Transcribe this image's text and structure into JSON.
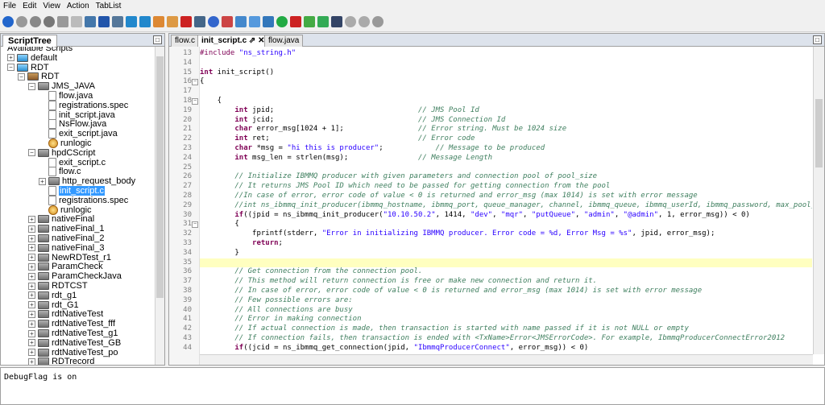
{
  "menu": [
    "File",
    "Edit",
    "View",
    "Action",
    "TabList"
  ],
  "toolbar_icons": [
    {
      "name": "run-icon",
      "color": "#2266cc",
      "round": true
    },
    {
      "name": "stop-icon",
      "color": "#999999",
      "round": true
    },
    {
      "name": "record-icon",
      "color": "#888888",
      "round": true
    },
    {
      "name": "pause-icon",
      "color": "#777777",
      "round": true
    },
    {
      "name": "step-icon",
      "color": "#999999",
      "round": false
    },
    {
      "name": "comment-icon",
      "color": "#bbbbbb",
      "round": false
    },
    {
      "name": "window-icon",
      "color": "#4477aa",
      "round": false
    },
    {
      "name": "save-icon",
      "color": "#2255aa",
      "round": false
    },
    {
      "name": "copy-icon",
      "color": "#557799",
      "round": false
    },
    {
      "name": "download-icon",
      "color": "#2288cc",
      "round": false
    },
    {
      "name": "upload-icon",
      "color": "#2288cc",
      "round": false
    },
    {
      "name": "palette-icon",
      "color": "#dd8833",
      "round": false
    },
    {
      "name": "tag-icon",
      "color": "#dd9944",
      "round": false
    },
    {
      "name": "delete-icon",
      "color": "#cc2222",
      "round": false
    },
    {
      "name": "search-icon",
      "color": "#446688",
      "round": false
    },
    {
      "name": "settings-icon",
      "color": "#3366cc",
      "round": true
    },
    {
      "name": "edit-icon",
      "color": "#cc4444",
      "round": false
    },
    {
      "name": "disk-icon",
      "color": "#4488cc",
      "round": false
    },
    {
      "name": "network-icon",
      "color": "#5599dd",
      "round": false
    },
    {
      "name": "list-icon",
      "color": "#3377bb",
      "round": false
    },
    {
      "name": "refresh-icon",
      "color": "#22aa44",
      "round": true
    },
    {
      "name": "flag-icon",
      "color": "#cc2222",
      "round": false
    },
    {
      "name": "chart-icon",
      "color": "#44aa44",
      "round": false
    },
    {
      "name": "export-icon",
      "color": "#33aa55",
      "round": false
    },
    {
      "name": "floppy-icon",
      "color": "#334466",
      "round": false
    },
    {
      "name": "undo-icon",
      "color": "#aaaaaa",
      "round": true
    },
    {
      "name": "forward-icon",
      "color": "#aaaaaa",
      "round": true
    },
    {
      "name": "record-stop-icon",
      "color": "#999999",
      "round": true
    }
  ],
  "left_panel": {
    "tab_label": "ScriptTree",
    "tree": [
      {
        "label": "Available Scripts",
        "depth": 0,
        "exp": "",
        "icon": "",
        "partial": true
      },
      {
        "label": "default",
        "depth": 0,
        "exp": "+",
        "icon": "db"
      },
      {
        "label": "RDT",
        "depth": 0,
        "exp": "−",
        "icon": "db"
      },
      {
        "label": "RDT",
        "depth": 1,
        "exp": "−",
        "icon": "box"
      },
      {
        "label": "JMS_JAVA",
        "depth": 2,
        "exp": "−",
        "icon": "folder"
      },
      {
        "label": "flow.java",
        "depth": 3,
        "exp": "",
        "icon": "file"
      },
      {
        "label": "registrations.spec",
        "depth": 3,
        "exp": "",
        "icon": "file"
      },
      {
        "label": "init_script.java",
        "depth": 3,
        "exp": "",
        "icon": "file"
      },
      {
        "label": "NsFlow.java",
        "depth": 3,
        "exp": "",
        "icon": "file"
      },
      {
        "label": "exit_script.java",
        "depth": 3,
        "exp": "",
        "icon": "file"
      },
      {
        "label": "runlogic",
        "depth": 3,
        "exp": "",
        "icon": "logic"
      },
      {
        "label": "hpdCScript",
        "depth": 2,
        "exp": "−",
        "icon": "folder"
      },
      {
        "label": "exit_script.c",
        "depth": 3,
        "exp": "",
        "icon": "file"
      },
      {
        "label": "flow.c",
        "depth": 3,
        "exp": "",
        "icon": "file"
      },
      {
        "label": "http_request_body",
        "depth": 3,
        "exp": "+",
        "icon": "folder"
      },
      {
        "label": "init_script.c",
        "depth": 3,
        "exp": "",
        "icon": "file",
        "selected": true
      },
      {
        "label": "registrations.spec",
        "depth": 3,
        "exp": "",
        "icon": "file"
      },
      {
        "label": "runlogic",
        "depth": 3,
        "exp": "",
        "icon": "logic"
      },
      {
        "label": "nativeFinal",
        "depth": 2,
        "exp": "+",
        "icon": "folder"
      },
      {
        "label": "nativeFinal_1",
        "depth": 2,
        "exp": "+",
        "icon": "folder"
      },
      {
        "label": "nativeFinal_2",
        "depth": 2,
        "exp": "+",
        "icon": "folder"
      },
      {
        "label": "nativeFinal_3",
        "depth": 2,
        "exp": "+",
        "icon": "folder"
      },
      {
        "label": "NewRDTest_r1",
        "depth": 2,
        "exp": "+",
        "icon": "folder"
      },
      {
        "label": "ParamCheck",
        "depth": 2,
        "exp": "+",
        "icon": "folder"
      },
      {
        "label": "ParamCheckJava",
        "depth": 2,
        "exp": "+",
        "icon": "folder"
      },
      {
        "label": "RDTCST",
        "depth": 2,
        "exp": "+",
        "icon": "folder"
      },
      {
        "label": "rdt_g1",
        "depth": 2,
        "exp": "+",
        "icon": "folder"
      },
      {
        "label": "rdt_G1",
        "depth": 2,
        "exp": "+",
        "icon": "folder"
      },
      {
        "label": "rdtNativeTest",
        "depth": 2,
        "exp": "+",
        "icon": "folder"
      },
      {
        "label": "rdtNativeTest_fff",
        "depth": 2,
        "exp": "+",
        "icon": "folder"
      },
      {
        "label": "rdtNativeTest_g1",
        "depth": 2,
        "exp": "+",
        "icon": "folder"
      },
      {
        "label": "rdtNativeTest_GB",
        "depth": 2,
        "exp": "+",
        "icon": "folder"
      },
      {
        "label": "rdtNativeTest_po",
        "depth": 2,
        "exp": "+",
        "icon": "folder"
      },
      {
        "label": "RDTrecord",
        "depth": 2,
        "exp": "+",
        "icon": "folder"
      }
    ]
  },
  "editor": {
    "tabs": [
      {
        "label": "flow.c",
        "active": false
      },
      {
        "label": "init_script.c",
        "active": true,
        "pin": "⇗",
        "close": "✕"
      },
      {
        "label": "flow.java",
        "active": false
      }
    ],
    "highlight_line": 35,
    "lines": [
      {
        "n": 13,
        "fold": "",
        "t": [
          [
            "pp",
            "#include "
          ],
          [
            "str",
            "\"ns_string.h\""
          ]
        ]
      },
      {
        "n": 14,
        "fold": "",
        "t": []
      },
      {
        "n": 15,
        "fold": "",
        "t": [
          [
            "kw",
            "int"
          ],
          [
            "pl",
            " init_script()"
          ]
        ]
      },
      {
        "n": 16,
        "fold": "−",
        "t": [
          [
            "pl",
            "{"
          ]
        ]
      },
      {
        "n": 17,
        "fold": "",
        "t": []
      },
      {
        "n": 18,
        "fold": "−",
        "t": [
          [
            "pl",
            "    {"
          ]
        ]
      },
      {
        "n": 19,
        "fold": "",
        "t": [
          [
            "pl",
            "        "
          ],
          [
            "kw",
            "int"
          ],
          [
            "pl",
            " jpid;                                 "
          ],
          [
            "cm",
            "// JMS Pool Id"
          ]
        ]
      },
      {
        "n": 20,
        "fold": "",
        "t": [
          [
            "pl",
            "        "
          ],
          [
            "kw",
            "int"
          ],
          [
            "pl",
            " jcid;                                 "
          ],
          [
            "cm",
            "// JMS Connection Id"
          ]
        ]
      },
      {
        "n": 21,
        "fold": "",
        "t": [
          [
            "pl",
            "        "
          ],
          [
            "kw",
            "char"
          ],
          [
            "pl",
            " error_msg[1024 + 1];                 "
          ],
          [
            "cm",
            "// Error string. Must be 1024 size"
          ]
        ]
      },
      {
        "n": 22,
        "fold": "",
        "t": [
          [
            "pl",
            "        "
          ],
          [
            "kw",
            "int"
          ],
          [
            "pl",
            " ret;                                  "
          ],
          [
            "cm",
            "// Error code"
          ]
        ]
      },
      {
        "n": 23,
        "fold": "",
        "t": [
          [
            "pl",
            "        "
          ],
          [
            "kw",
            "char"
          ],
          [
            "pl",
            " *msg = "
          ],
          [
            "str",
            "\"hi this is producer\""
          ],
          [
            "pl",
            ";            "
          ],
          [
            "cm",
            "// Message to be produced"
          ]
        ]
      },
      {
        "n": 24,
        "fold": "",
        "t": [
          [
            "pl",
            "        "
          ],
          [
            "kw",
            "int"
          ],
          [
            "pl",
            " msg_len = strlen(msg);                "
          ],
          [
            "cm",
            "// Message Length"
          ]
        ]
      },
      {
        "n": 25,
        "fold": "",
        "t": []
      },
      {
        "n": 26,
        "fold": "",
        "t": [
          [
            "pl",
            "        "
          ],
          [
            "cm",
            "// Initialize IBMMQ producer with given parameters and connection pool of pool_size"
          ]
        ]
      },
      {
        "n": 27,
        "fold": "",
        "t": [
          [
            "pl",
            "        "
          ],
          [
            "cm",
            "// It returns JMS Pool ID which need to be passed for getting connection from the pool"
          ]
        ]
      },
      {
        "n": 28,
        "fold": "",
        "t": [
          [
            "pl",
            "        "
          ],
          [
            "cm",
            "//In case of error, error code of value < 0 is returned and error_msg (max 1014) is set with error message"
          ]
        ]
      },
      {
        "n": 29,
        "fold": "",
        "t": [
          [
            "pl",
            "        "
          ],
          [
            "cm",
            "//int ns_ibmmq_init_producer(ibmmq_hostname, ibmmq_port, queue_manager, channel, ibmmq_queue, ibmmq_userId, ibmmq_password, max_pool_size"
          ]
        ]
      },
      {
        "n": 30,
        "fold": "",
        "t": [
          [
            "pl",
            "        "
          ],
          [
            "kw",
            "if"
          ],
          [
            "pl",
            "((jpid = ns_ibmmq_init_producer("
          ],
          [
            "str",
            "\"10.10.50.2\""
          ],
          [
            "pl",
            ", 1414, "
          ],
          [
            "str",
            "\"dev\""
          ],
          [
            "pl",
            ", "
          ],
          [
            "str",
            "\"mqr\""
          ],
          [
            "pl",
            ", "
          ],
          [
            "str",
            "\"putQueue\""
          ],
          [
            "pl",
            ", "
          ],
          [
            "str",
            "\"admin\""
          ],
          [
            "pl",
            ", "
          ],
          [
            "str",
            "\"@admin\""
          ],
          [
            "pl",
            ", 1, error_msg)) < 0)"
          ]
        ]
      },
      {
        "n": 31,
        "fold": "−",
        "t": [
          [
            "pl",
            "        {"
          ]
        ]
      },
      {
        "n": 32,
        "fold": "",
        "t": [
          [
            "pl",
            "            fprintf(stderr, "
          ],
          [
            "str",
            "\"Error in initializing IBMMQ producer. Error code = %d, Error Msg = %s\""
          ],
          [
            "pl",
            ", jpid, error_msg);"
          ]
        ]
      },
      {
        "n": 33,
        "fold": "",
        "t": [
          [
            "pl",
            "            "
          ],
          [
            "kw",
            "return"
          ],
          [
            "pl",
            ";"
          ]
        ]
      },
      {
        "n": 34,
        "fold": "",
        "t": [
          [
            "pl",
            "        }"
          ]
        ]
      },
      {
        "n": 35,
        "fold": "",
        "t": []
      },
      {
        "n": 36,
        "fold": "",
        "t": [
          [
            "pl",
            "        "
          ],
          [
            "cm",
            "// Get connection from the connection pool."
          ]
        ]
      },
      {
        "n": 37,
        "fold": "",
        "t": [
          [
            "pl",
            "        "
          ],
          [
            "cm",
            "// This method will return connection is free or make new connection and return it."
          ]
        ]
      },
      {
        "n": 38,
        "fold": "",
        "t": [
          [
            "pl",
            "        "
          ],
          [
            "cm",
            "// In case of error, error code of value < 0 is returned and error_msg (max 1014) is set with error message"
          ]
        ]
      },
      {
        "n": 39,
        "fold": "",
        "t": [
          [
            "pl",
            "        "
          ],
          [
            "cm",
            "// Few possible errors are:"
          ]
        ]
      },
      {
        "n": 40,
        "fold": "",
        "t": [
          [
            "pl",
            "        "
          ],
          [
            "cm",
            "// All connections are busy"
          ]
        ]
      },
      {
        "n": 41,
        "fold": "",
        "t": [
          [
            "pl",
            "        "
          ],
          [
            "cm",
            "// Error in making connection"
          ]
        ]
      },
      {
        "n": 42,
        "fold": "",
        "t": [
          [
            "pl",
            "        "
          ],
          [
            "cm",
            "// If actual connection is made, then transaction is started with name passed if it is not NULL or empty"
          ]
        ]
      },
      {
        "n": 43,
        "fold": "",
        "t": [
          [
            "pl",
            "        "
          ],
          [
            "cm",
            "// If connection fails, then transaction is ended with <TxName>Error<JMSErrorCode>. For example, IbmmqProducerConnectError2012"
          ]
        ]
      },
      {
        "n": 44,
        "fold": "",
        "t": [
          [
            "pl",
            "        "
          ],
          [
            "kw",
            "if"
          ],
          [
            "pl",
            "((jcid = ns_ibmmq_get_connection(jpid, "
          ],
          [
            "str",
            "\"IbmmqProducerConnect\""
          ],
          [
            "pl",
            ", error_msg)) < 0)"
          ]
        ]
      }
    ]
  },
  "console": {
    "text": "DebugFlag is on"
  }
}
